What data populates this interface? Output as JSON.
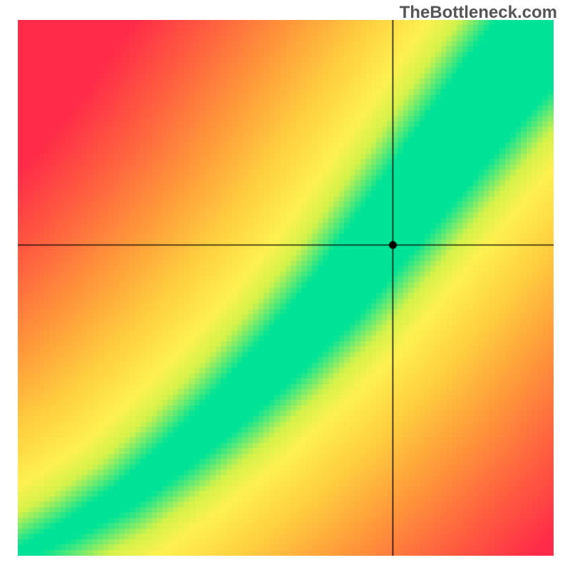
{
  "watermark": "TheBottleneck.com",
  "chart_data": {
    "type": "heatmap",
    "title": "",
    "xlabel": "",
    "ylabel": "",
    "xlim": [
      0,
      100
    ],
    "ylim": [
      0,
      100
    ],
    "crosshair": {
      "x": 70,
      "y": 58
    },
    "marker": {
      "x": 70,
      "y": 58
    },
    "optimal_band": {
      "description": "Green band along a superlinear curve from bottom-left to top-right; widening toward top-right.",
      "center_curve_points": [
        {
          "x": 0,
          "y": 0
        },
        {
          "x": 10,
          "y": 5
        },
        {
          "x": 20,
          "y": 11
        },
        {
          "x": 30,
          "y": 19
        },
        {
          "x": 40,
          "y": 28
        },
        {
          "x": 50,
          "y": 38
        },
        {
          "x": 60,
          "y": 49
        },
        {
          "x": 70,
          "y": 62
        },
        {
          "x": 80,
          "y": 75
        },
        {
          "x": 90,
          "y": 88
        },
        {
          "x": 100,
          "y": 100
        }
      ],
      "band_halfwidth_at_x": [
        {
          "x": 0,
          "halfwidth": 1.2
        },
        {
          "x": 20,
          "halfwidth": 2.5
        },
        {
          "x": 40,
          "halfwidth": 4.0
        },
        {
          "x": 60,
          "halfwidth": 5.5
        },
        {
          "x": 80,
          "halfwidth": 7.0
        },
        {
          "x": 100,
          "halfwidth": 8.5
        }
      ]
    },
    "color_scale": {
      "stops": [
        {
          "d": 0.0,
          "color": "#00e397"
        },
        {
          "d": 0.1,
          "color": "#d4f24a"
        },
        {
          "d": 0.18,
          "color": "#fef150"
        },
        {
          "d": 0.35,
          "color": "#ffce3f"
        },
        {
          "d": 0.55,
          "color": "#ff9a3a"
        },
        {
          "d": 0.8,
          "color": "#ff5a40"
        },
        {
          "d": 1.0,
          "color": "#ff2b49"
        }
      ],
      "description": "Distance from optimal band normalized 0..1"
    },
    "grid_resolution": 100
  }
}
